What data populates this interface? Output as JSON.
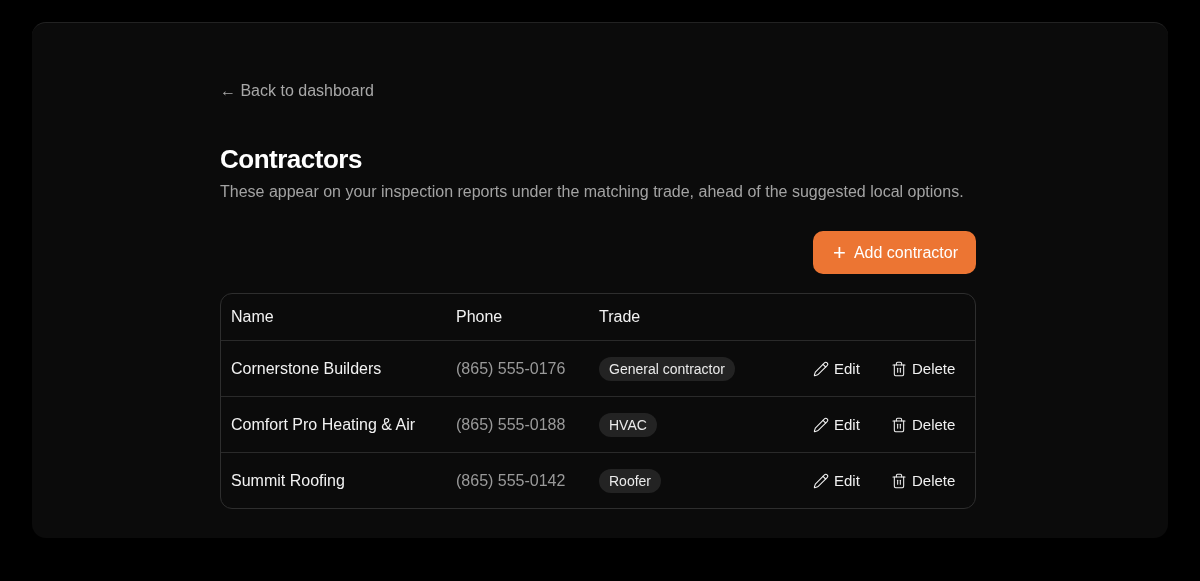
{
  "back_link": "← Back to dashboard",
  "title": "Contractors",
  "subtitle": "These appear on your inspection reports under the matching trade, ahead of the suggested local options.",
  "add_button": {
    "icon": "+",
    "label": "Add contractor"
  },
  "table": {
    "columns": [
      "Name",
      "Phone",
      "Trade"
    ],
    "rows": [
      {
        "name": "Cornerstone Builders",
        "phone": "(865) 555-0176",
        "trade": "General contractor",
        "actions": [
          "Edit",
          "Delete"
        ]
      },
      {
        "name": "Comfort Pro Heating & Air",
        "phone": "(865) 555-0188",
        "trade": "HVAC",
        "actions": [
          "Edit",
          "Delete"
        ]
      },
      {
        "name": "Summit Roofing",
        "phone": "(865) 555-0142",
        "trade": "Roofer",
        "actions": [
          "Edit",
          "Delete"
        ]
      }
    ]
  }
}
